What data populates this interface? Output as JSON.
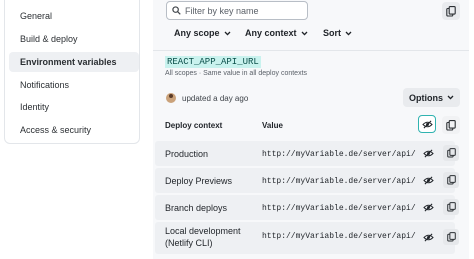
{
  "sidebar": {
    "items": [
      {
        "label": "General"
      },
      {
        "label": "Build & deploy"
      },
      {
        "label": "Environment variables",
        "active": true
      },
      {
        "label": "Notifications"
      },
      {
        "label": "Identity"
      },
      {
        "label": "Access & security"
      }
    ]
  },
  "toolbar": {
    "search_placeholder": "Filter by key name",
    "scope_label": "Any scope",
    "context_label": "Any context",
    "sort_label": "Sort"
  },
  "variable": {
    "key": "REACT_APP_API_URL",
    "meta": "All scopes · Same value in all deploy contexts",
    "updated": "updated a day ago",
    "options_label": "Options"
  },
  "table": {
    "col_context": "Deploy context",
    "col_value": "Value",
    "rows": [
      {
        "context": "Production",
        "value": "http://myVariable.de/server/api/"
      },
      {
        "context": "Deploy Previews",
        "value": "http://myVariable.de/server/api/"
      },
      {
        "context": "Branch deploys",
        "value": "http://myVariable.de/server/api/"
      },
      {
        "context_line1": "Local development",
        "context_line2": "(Netlify CLI)",
        "value": "http://myVariable.de/server/api/"
      }
    ]
  },
  "colors": {
    "key_highlight": "#c9f2ee",
    "focus_ring": "#30b3b0"
  },
  "icons": [
    "search-icon",
    "copy-icon",
    "chevron-down-icon",
    "eye-slash-icon",
    "avatar"
  ]
}
